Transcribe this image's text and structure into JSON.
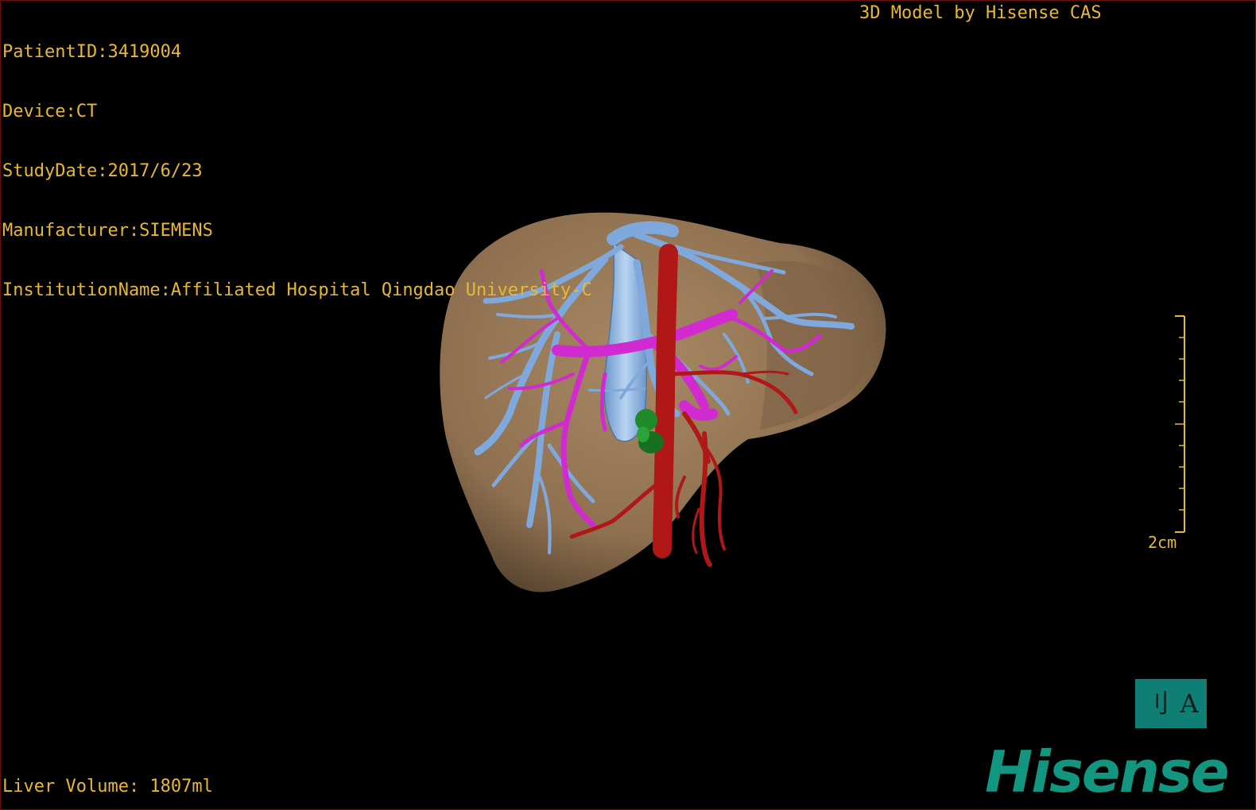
{
  "overlay": {
    "patient_id": "PatientID:3419004",
    "device": "Device:CT",
    "study_date": "StudyDate:2017/6/23",
    "manufacturer": "Manufacturer:SIEMENS",
    "institution": "InstitutionName:Affiliated Hospital Qingdao University-C",
    "model_credit": "3D Model by Hisense CAS",
    "liver_volume": "Liver Volume: 1807ml"
  },
  "scale": {
    "label": "2cm"
  },
  "orientation": {
    "left_glyph": "刂",
    "right_glyph": "A"
  },
  "brand": {
    "logo_text": "Hisense"
  },
  "colors": {
    "overlay_text": "#e8b830",
    "liver": "#9c7d58",
    "hepatic_vein": "#7fa8dc",
    "portal_vein": "#d02ad0",
    "artery": "#b01818",
    "lesion": "#1f8a2a",
    "brand": "#12967f",
    "frame_border": "#6b1010"
  },
  "icons": {
    "orientation": "orientation-toggle-icon",
    "scale": "scale-ruler-icon"
  }
}
